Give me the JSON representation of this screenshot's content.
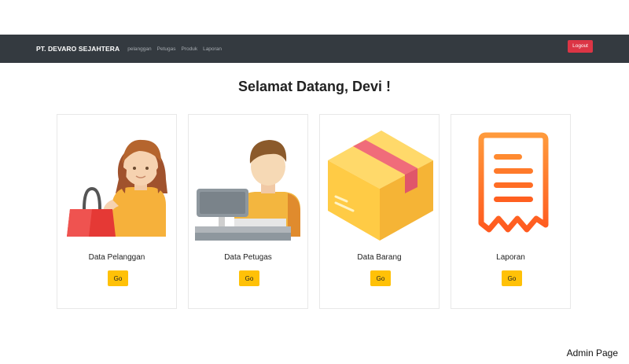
{
  "navbar": {
    "brand": "PT. DEVARO SEJAHTERA",
    "links": [
      "pelanggan",
      "Petugas",
      "Produk",
      "Laporan"
    ],
    "logout_label": "Logout"
  },
  "main": {
    "greeting": "Selamat Datang, Devi !",
    "cards": [
      {
        "label": "Data Pelanggan",
        "button": "Go",
        "icon": "shopper-woman-icon"
      },
      {
        "label": "Data Petugas",
        "button": "Go",
        "icon": "cashier-man-icon"
      },
      {
        "label": "Data Barang",
        "button": "Go",
        "icon": "package-box-icon"
      },
      {
        "label": "Laporan",
        "button": "Go",
        "icon": "receipt-icon"
      }
    ]
  },
  "footer": {
    "note": "Admin Page"
  },
  "colors": {
    "navbar": "#343a40",
    "logout": "#dc3545",
    "go_button": "#ffc107"
  }
}
